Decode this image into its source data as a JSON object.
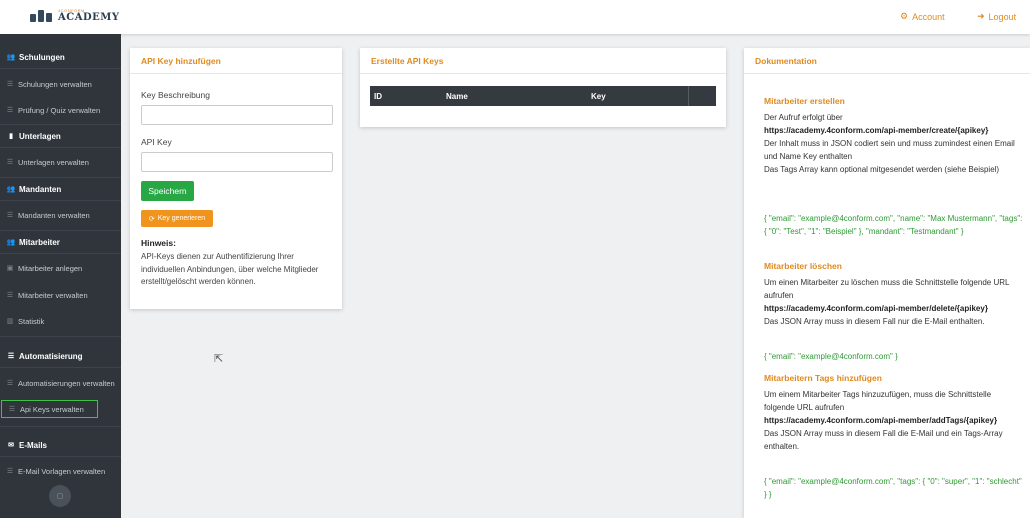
{
  "header": {
    "logo_small": "4CONFORM",
    "logo_big": "ACADEMY",
    "account_label": "Account",
    "logout_label": "Logout",
    "accent_color": "#e08a1e"
  },
  "sidebar": {
    "sections": [
      {
        "label": "Schulungen",
        "icon": "users-icon"
      },
      {
        "label": "Unterlagen",
        "icon": "file-icon"
      },
      {
        "label": "Mandanten",
        "icon": "users-icon"
      },
      {
        "label": "Mitarbeiter",
        "icon": "users-icon"
      },
      {
        "label": "Automatisierung",
        "icon": "list-icon"
      },
      {
        "label": "E-Mails",
        "icon": "envelope-icon"
      }
    ],
    "items": [
      {
        "label": "Schulungen verwalten"
      },
      {
        "label": "Prüfung / Quiz verwalten"
      },
      {
        "label": "Unterlagen verwalten"
      },
      {
        "label": "Mandanten verwalten"
      },
      {
        "label": "Mitarbeiter anlegen"
      },
      {
        "label": "Mitarbeiter verwalten"
      },
      {
        "label": "Statistik"
      },
      {
        "label": "Automatisierungen verwalten"
      },
      {
        "label": "Api Keys verwalten",
        "active": true
      },
      {
        "label": "E-Mail Vorlagen verwalten"
      }
    ]
  },
  "add_card": {
    "title": "API Key hinzufügen",
    "desc_label": "Key Beschreibung",
    "desc_value": "",
    "key_label": "API Key",
    "key_value": "",
    "save_label": "Speichern",
    "generate_label": "Key generieren",
    "hint_title": "Hinweis:",
    "hint_text": "API-Keys dienen zur Authentifizierung Ihrer individuellen Anbindungen, über welche Mitglieder erstellt/gelöscht werden können."
  },
  "keys_card": {
    "title": "Erstellte API Keys",
    "columns": [
      "ID",
      "Name",
      "Key"
    ]
  },
  "doc_card": {
    "title": "Dokumentation",
    "create": {
      "heading": "Mitarbeiter erstellen",
      "line1": "Der Aufruf erfolgt über",
      "url": "https://academy.4conform.com/api-member/create/{apikey}",
      "line2": "Der Inhalt muss in JSON codiert sein und muss zumindest einen Email und Name Key enthalten",
      "line3": "Das Tags Array kann optional mitgesendet werden (siehe Beispiel)",
      "example": "{ \"email\": \"example@4conform.com\", \"name\": \"Max Mustermann\", \"tags\": { \"0\": \"Test\", \"1\": \"Beispiel\" }, \"mandant\": \"Testmandant\" }"
    },
    "delete": {
      "heading": "Mitarbeiter löschen",
      "line1": "Um einen Mitarbeiter zu löschen muss die Schnittstelle folgende URL aufrufen",
      "url": "https://academy.4conform.com/api-member/delete/{apikey}",
      "line2": "Das JSON Array muss in diesem Fall nur die E-Mail enthalten.",
      "example": "{ \"email\": \"example@4conform.com\" }"
    },
    "tags": {
      "heading": "Mitarbeitern Tags hinzufügen",
      "line1": "Um einem Mitarbeiter Tags hinzuzufügen, muss die Schnittstelle folgende URL aufrufen",
      "url": "https://academy.4conform.com/api-member/addTags/{apikey}",
      "line2": "Das JSON Array muss in diesem Fall die E-Mail und ein Tags-Array enthalten.",
      "example": "{ \"email\": \"example@4conform.com\", \"tags\": { \"0\": \"super\", \"1\": \"schlecht\" } }"
    }
  }
}
